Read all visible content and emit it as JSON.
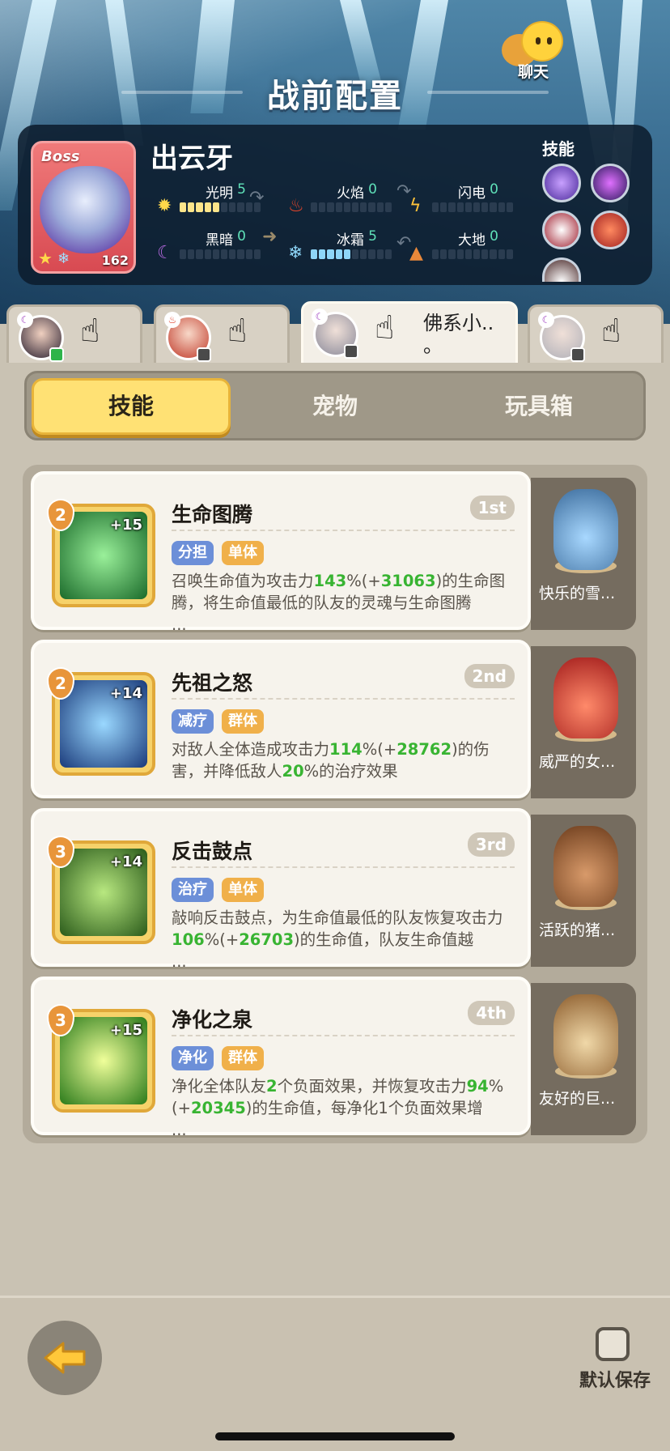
{
  "header": {
    "title": "战前配置",
    "chat_label": "聊天"
  },
  "boss": {
    "tag": "Boss",
    "name": "出云牙",
    "level": "162",
    "skills_label": "技能",
    "stats": [
      {
        "label": "光明",
        "value": "5",
        "filled": 5,
        "color": "yellow"
      },
      {
        "label": "火焰",
        "value": "0",
        "filled": 0,
        "color": "red"
      },
      {
        "label": "闪电",
        "value": "0",
        "filled": 0,
        "color": "yellow"
      },
      {
        "label": "黑暗",
        "value": "0",
        "filled": 0,
        "color": "purple"
      },
      {
        "label": "冰霜",
        "value": "5",
        "filled": 5,
        "color": "blue"
      },
      {
        "label": "大地",
        "value": "0",
        "filled": 0,
        "color": "brown"
      }
    ]
  },
  "hero_tabs": [
    {
      "name": "",
      "element": "dark",
      "active": false
    },
    {
      "name": "",
      "element": "fire",
      "active": false
    },
    {
      "name": "佛系小..\n。",
      "element": "dark",
      "active": true
    },
    {
      "name": "",
      "element": "dark",
      "active": false
    }
  ],
  "segments": [
    "技能",
    "宠物",
    "玩具箱"
  ],
  "active_segment": "技能",
  "skills": [
    {
      "level": "2",
      "plus": "+15",
      "name": "生命图腾",
      "order": "1st",
      "tags": [
        "分担",
        "单体"
      ],
      "desc": [
        "召唤生命值为攻击力",
        "143",
        "%(+",
        "31063",
        ")的生命图腾，将生命值最低的队友的灵魂与生命图腾"
      ],
      "more": "...",
      "pet": "快乐的雪..."
    },
    {
      "level": "2",
      "plus": "+14",
      "name": "先祖之怒",
      "order": "2nd",
      "tags": [
        "减疗",
        "群体"
      ],
      "desc": [
        "对敌人全体造成攻击力",
        "114",
        "%(+",
        "28762",
        ")的伤害，并降低敌人",
        "20",
        "%的治疗效果"
      ],
      "more": "",
      "pet": "威严的女..."
    },
    {
      "level": "3",
      "plus": "+14",
      "name": "反击鼓点",
      "order": "3rd",
      "tags": [
        "治疗",
        "单体"
      ],
      "desc": [
        "敲响反击鼓点，为生命值最低的队友恢复攻击力",
        "106",
        "%(+",
        "26703",
        ")的生命值，队友生命值越"
      ],
      "more": "...",
      "pet": "活跃的猪..."
    },
    {
      "level": "3",
      "plus": "+15",
      "name": "净化之泉",
      "order": "4th",
      "tags": [
        "净化",
        "群体"
      ],
      "desc": [
        "净化全体队友",
        "2",
        "个负面效果，并恢复攻击力",
        "94",
        "%(+",
        "20345",
        ")的生命值，每净化1个负面效果增"
      ],
      "more": "...",
      "pet": "友好的巨..."
    }
  ],
  "footer": {
    "save_label": "默认保存"
  }
}
